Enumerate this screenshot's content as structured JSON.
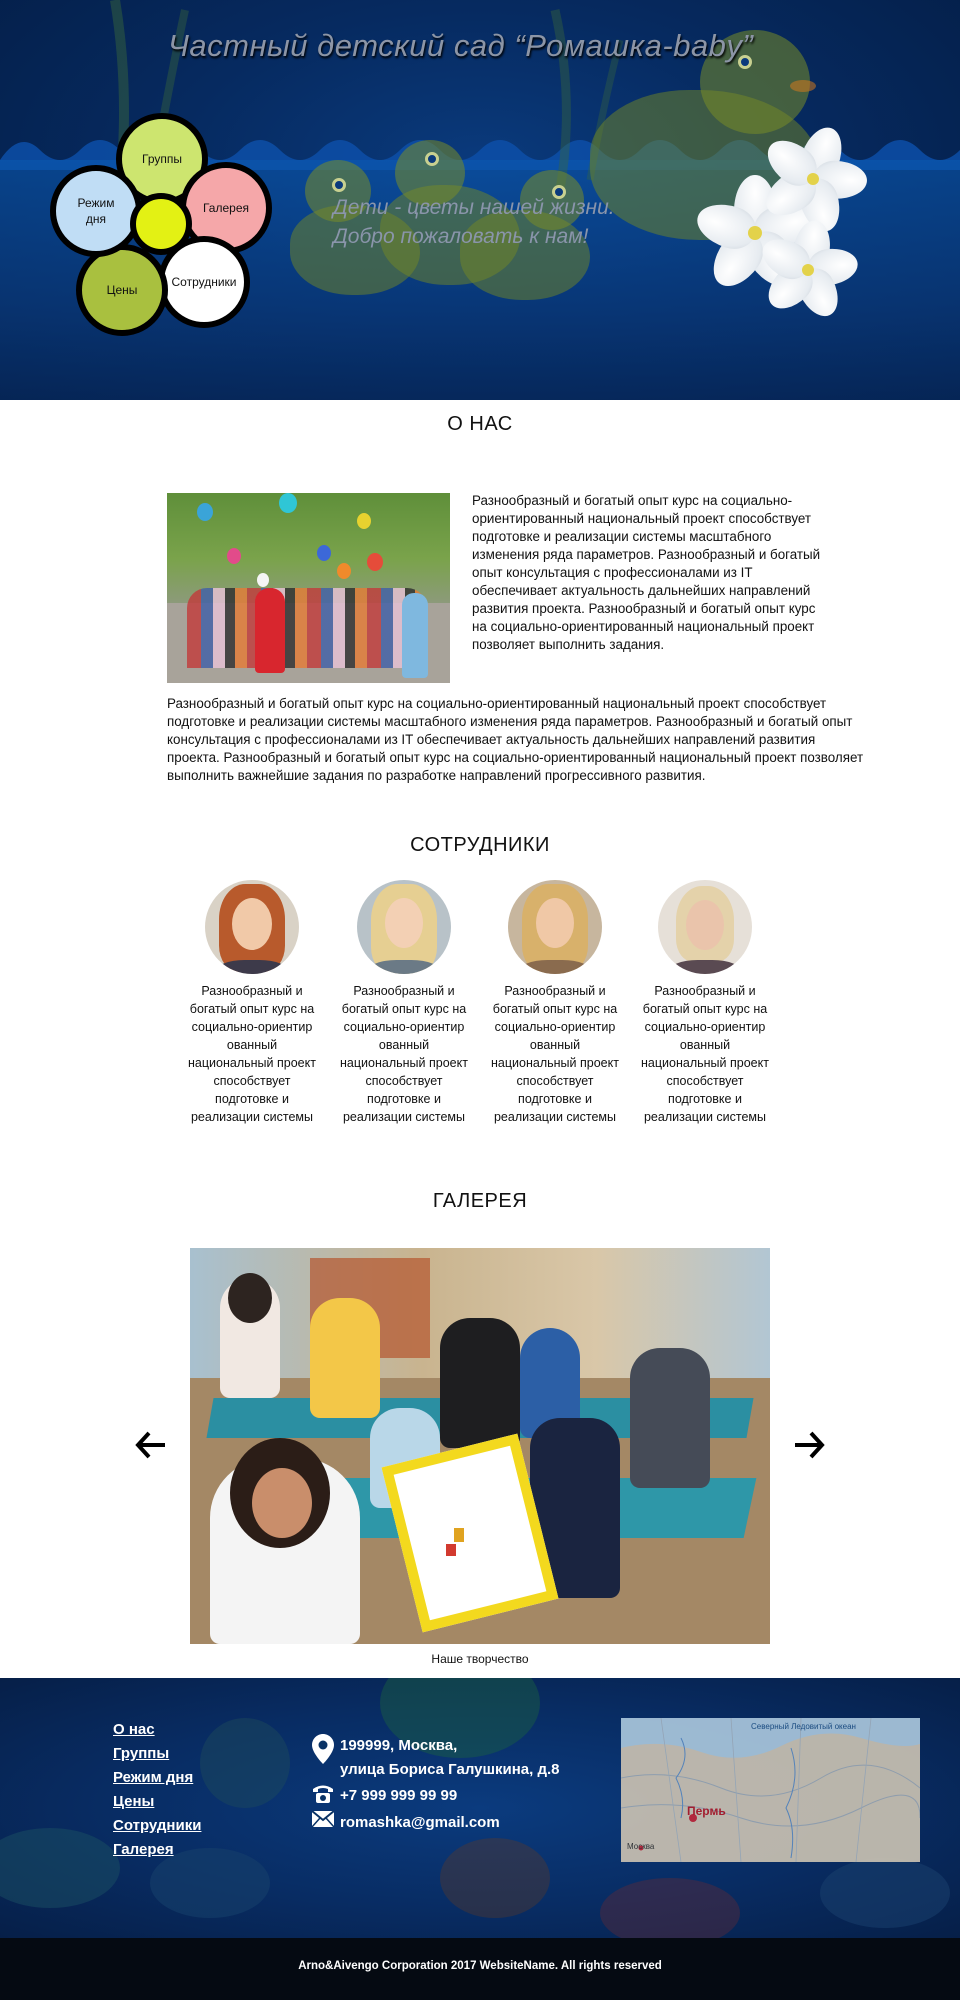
{
  "header": {
    "site_title": "Частный детский сад “Ромашка-baby”",
    "tagline_line1": "Дети - цветы нашей жизни.",
    "tagline_line2": "Добро пожаловать к нам!",
    "flower_nav": [
      {
        "label": "Группы",
        "color": "#cde56f"
      },
      {
        "label": "Галерея",
        "color": "#f5a7a9"
      },
      {
        "label": "Сотрудники",
        "color": "#ffffff"
      },
      {
        "label": "Цены",
        "color": "#a9c03f"
      },
      {
        "label": "Режим дня",
        "color": "#c0ddf5"
      }
    ],
    "colors": {
      "background": "#062a60",
      "flower_center": "#e3f114"
    }
  },
  "about": {
    "title": "О НАС",
    "photo_icon": "children-party-photo",
    "text_right": "Разнообразный и богатый опыт курс на социально-ориентированный национальный проект способствует подготовке и реализации системы масштабного изменения ряда параметров. Разнообразный и богатый опыт консультация с профессионалами из IT обеспечивает актуальность дальнейших направлений развития проекта. Разнообразный и богатый опыт курс на социально-ориентированный национальный проект позволяет выполнить задания.",
    "text_bottom": "Разнообразный и богатый опыт курс на социально-ориентированный национальный проект способствует подготовке и реализации системы масштабного изменения ряда параметров. Разнообразный и богатый опыт консультация с профессионалами из IT обеспечивает актуальность дальнейших направлений развития проекта. Разнообразный и богатый опыт курс на социально-ориентированный национальный проект позволяет выполнить важнейшие задания по разработке направлений прогрессивного развития."
  },
  "staff": {
    "title": "СОТРУДНИКИ",
    "members": [
      {
        "text": "Разнообразный и богатый опыт курс на социально-ориентир ованный национальный проект способствует подготовке и реализации системы",
        "hair": "#b85a2c",
        "skin": "#f1c9a8"
      },
      {
        "text": "Разнообразный и богатый опыт курс на социально-ориентир ованный национальный проект способствует подготовке и реализации системы",
        "hair": "#e6cf92",
        "skin": "#f3d0b4"
      },
      {
        "text": "Разнообразный и богатый опыт курс на социально-ориентир ованный национальный проект способствует подготовке и реализации системы",
        "hair": "#d8b16b",
        "skin": "#f0c8a6"
      },
      {
        "text": "Разнообразный и богатый опыт курс на социально-ориентир ованный национальный проект способствует подготовке и реализации системы",
        "hair": "#e4d2aa",
        "skin": "#eac4ab"
      }
    ]
  },
  "gallery": {
    "title": "ГАЛЕРЕЯ",
    "caption": "Наше творчество",
    "prev_icon": "arrow-left-icon",
    "next_icon": "arrow-right-icon"
  },
  "footer": {
    "nav": [
      "О нас",
      "Группы",
      "Режим дня",
      "Цены",
      "Сотрудники",
      "Галерея"
    ],
    "address_line1": "199999, Москва,",
    "address_line2": "улица Бориса Галушкина, д.8",
    "phone": "+7 999 999 99 99",
    "email": "romashka@gmail.com",
    "map_labels": {
      "city": "Пермь",
      "sea1": "Северный Ледовитый океан",
      "city2": "Москва"
    },
    "copyright": "Arno&Aivengo Corporation 2017 WebsiteName. All rights reserved"
  }
}
